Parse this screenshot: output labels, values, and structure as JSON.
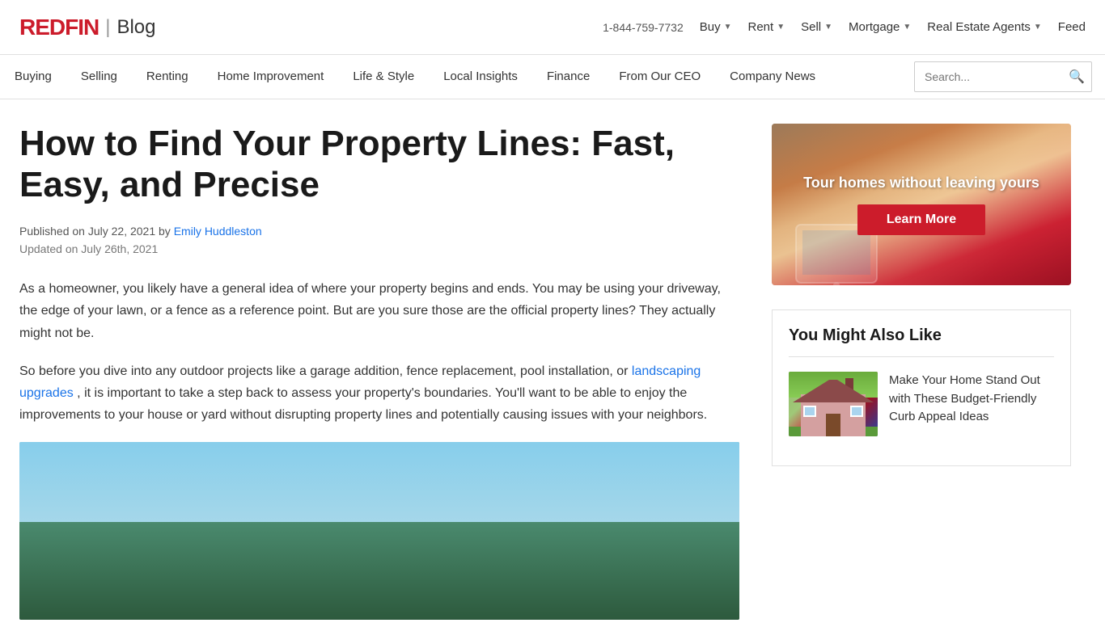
{
  "top_nav": {
    "logo_redfin": "REDFIN",
    "logo_separator": "|",
    "logo_blog": "Blog",
    "phone": "1-844-759-7732",
    "nav_items": [
      {
        "label": "Buy",
        "has_arrow": true
      },
      {
        "label": "Rent",
        "has_arrow": true
      },
      {
        "label": "Sell",
        "has_arrow": true
      },
      {
        "label": "Mortgage",
        "has_arrow": true
      },
      {
        "label": "Real Estate Agents",
        "has_arrow": true
      },
      {
        "label": "Feed",
        "has_arrow": false
      }
    ]
  },
  "cat_nav": {
    "items": [
      {
        "label": "Buying"
      },
      {
        "label": "Selling"
      },
      {
        "label": "Renting"
      },
      {
        "label": "Home Improvement"
      },
      {
        "label": "Life & Style"
      },
      {
        "label": "Local Insights"
      },
      {
        "label": "Finance"
      },
      {
        "label": "From Our CEO"
      },
      {
        "label": "Company News"
      }
    ],
    "search_placeholder": "Search..."
  },
  "article": {
    "title": "How to Find Your Property Lines: Fast, Easy, and Precise",
    "published": "Published on July 22, 2021 by",
    "author_name": "Emily Huddleston",
    "updated": "Updated on July 26th, 2021",
    "paragraph1": "As a homeowner, you likely have a general idea of where your property begins and ends. You may be using your driveway, the edge of your lawn, or a fence as a reference point. But are you sure those are the official property lines? They actually might not be.",
    "paragraph2_prefix": "So before you dive into any outdoor projects like a garage addition, fence replacement, pool installation, or",
    "landscaping_link": "landscaping upgrades",
    "paragraph2_suffix": ", it is important to take a step back to assess your property's boundaries. You'll want to be able to enjoy the improvements to your house or yard without disrupting property lines and potentially causing issues with your neighbors."
  },
  "sidebar": {
    "ad": {
      "text": "Tour homes without leaving yours",
      "learn_more_label": "Learn More"
    },
    "you_might_also_like": {
      "title": "You Might Also Like",
      "items": [
        {
          "title": "Make Your Home Stand Out with These Budget-Friendly Curb Appeal Ideas"
        }
      ]
    }
  }
}
